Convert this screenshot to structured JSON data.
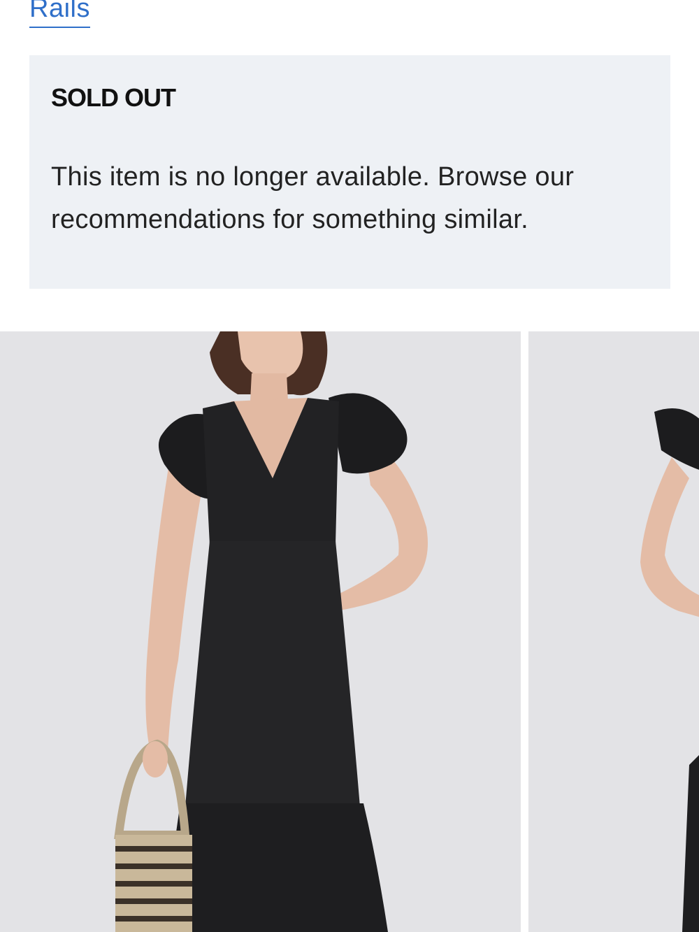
{
  "header": {
    "brand_link": "Rails"
  },
  "notice": {
    "title": "SOLD OUT",
    "message": "This item is no longer available. Browse our recommendations for something similar."
  },
  "gallery": {
    "images": [
      {
        "subject": "model-in-black-eyelet-dress-front"
      },
      {
        "subject": "model-in-black-eyelet-dress-partial"
      }
    ]
  },
  "colors": {
    "link": "#2f6fc9",
    "panel_bg": "#eef1f5",
    "photo_bg": "#e3e3e6",
    "dress": "#1f1f21"
  }
}
